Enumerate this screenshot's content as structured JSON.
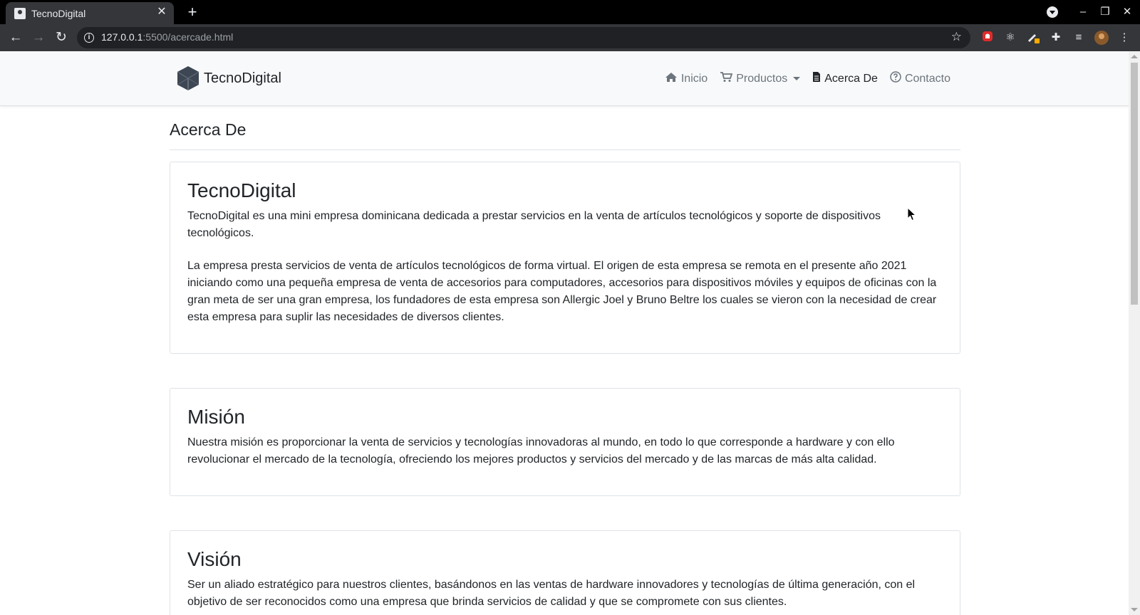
{
  "browser": {
    "tab_title": "TecnoDigital",
    "url_host": "127.0.0.1",
    "url_path": ":5500/acercade.html"
  },
  "navbar": {
    "brand": "TecnoDigital",
    "links": [
      {
        "label": "Inicio",
        "icon": "home-icon"
      },
      {
        "label": "Productos",
        "icon": "cart-icon"
      },
      {
        "label": "Acerca De",
        "icon": "file-icon"
      },
      {
        "label": "Contacto",
        "icon": "question-circle-icon"
      }
    ]
  },
  "main": {
    "title": "Acerca De",
    "sections": [
      {
        "heading": "TecnoDigital",
        "paragraphs": [
          "TecnoDigital es una mini empresa dominicana dedicada a prestar servicios en la venta de artículos tecnológicos y soporte de dispositivos tecnológicos.",
          "La empresa presta servicios de venta de artículos tecnológicos de forma virtual. El origen de esta empresa se remota en el presente año 2021 iniciando como una pequeña empresa de venta de accesorios para computadores, accesorios para dispositivos móviles y equipos de oficinas con la gran meta de ser una gran empresa, los fundadores de esta empresa son Allergic Joel y Bruno Beltre los cuales se vieron con la necesidad de crear esta empresa para suplir las necesidades de diversos clientes."
        ]
      },
      {
        "heading": "Misión",
        "paragraphs": [
          "Nuestra misión es proporcionar la venta de servicios y tecnologías innovadoras al mundo, en todo lo que corresponde a hardware y con ello revolucionar el mercado de la tecnología, ofreciendo los mejores productos y servicios del mercado y de las marcas de más alta calidad."
        ]
      },
      {
        "heading": "Visión",
        "paragraphs": [
          "Ser un aliado estratégico para nuestros clientes, basándonos en las ventas de hardware innovadores y tecnologías de última generación, con el objetivo de ser reconocidos como una empresa que brinda servicios de calidad y que se compromete con sus clientes."
        ]
      }
    ]
  }
}
